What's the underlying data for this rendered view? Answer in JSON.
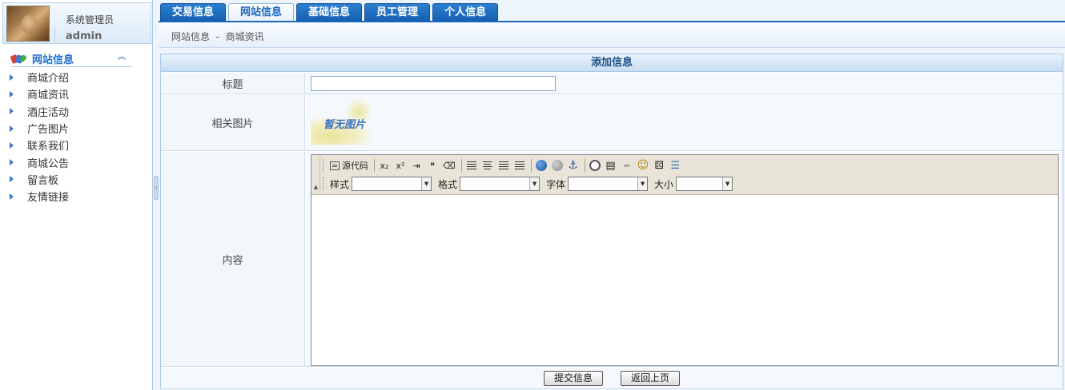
{
  "user": {
    "role": "系统管理员",
    "name": "admin"
  },
  "sidebar": {
    "heading": "网站信息",
    "items": [
      {
        "label": "商城介绍"
      },
      {
        "label": "商城资讯"
      },
      {
        "label": "酒庄活动"
      },
      {
        "label": "广告图片"
      },
      {
        "label": "联系我们"
      },
      {
        "label": "商城公告"
      },
      {
        "label": "留言板"
      },
      {
        "label": "友情链接"
      }
    ]
  },
  "tabs": [
    {
      "label": "交易信息",
      "active": false
    },
    {
      "label": "网站信息",
      "active": true
    },
    {
      "label": "基础信息",
      "active": false
    },
    {
      "label": "员工管理",
      "active": false
    },
    {
      "label": "个人信息",
      "active": false
    }
  ],
  "breadcrumb": {
    "text": "网站信息  -  商城资讯"
  },
  "form": {
    "title": "添加信息",
    "fields": {
      "title_label": "标题",
      "title_value": "",
      "image_label": "相关图片",
      "image_placeholder": "暂无图片",
      "content_label": "内容"
    },
    "editor": {
      "source_label": "源代码",
      "style_label": "样式",
      "format_label": "格式",
      "font_label": "字体",
      "size_label": "大小",
      "style_value": "",
      "format_value": "",
      "font_value": "",
      "size_value": ""
    },
    "buttons": {
      "submit": "提交信息",
      "back": "返回上页"
    }
  },
  "colors": {
    "tab_blue": "#1a66c2",
    "accent": "#1f6fcf"
  }
}
